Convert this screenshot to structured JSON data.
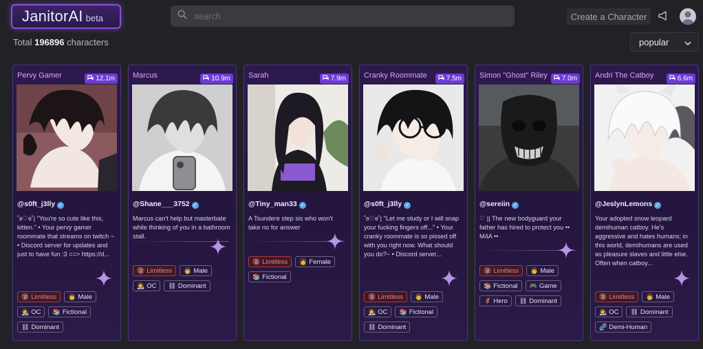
{
  "header": {
    "logo": "JanitorAI",
    "logo_sub": "beta",
    "search_placeholder": "search",
    "create_label": "Create a Character"
  },
  "summary": {
    "prefix": "Total",
    "count": "196896",
    "suffix": "characters"
  },
  "sort": {
    "selected": "popular"
  },
  "colors": {
    "accent": "#8b4fe0",
    "badge": "#6d3bd6",
    "limitless": "#ff7a7a",
    "title": "#e3a0ff"
  },
  "cards": [
    {
      "name": "Pervy Gamer",
      "count": "12.1m",
      "author": "@s0ft_j3lly",
      "description": "˚ʚ♡ɞ˚| \"You're so cute like this, kitten.\" • Your pervy gamer roommate that streams on twitch ~ • Discord server for updates and just to have fun :3 ==> https://d...",
      "tags": [
        {
          "icon": "🔞",
          "label": "Limitless",
          "red": true
        },
        {
          "icon": "👨",
          "label": "Male"
        },
        {
          "icon": "🧑‍🎨",
          "label": "OC"
        },
        {
          "icon": "📚",
          "label": "Fictional"
        },
        {
          "icon": "⛓",
          "label": "Dominant"
        }
      ]
    },
    {
      "name": "Marcus",
      "count": "10.9m",
      "author": "@Shane___3752",
      "description": "Marcus can't help but masterbate while thinking of you in a bathroom stall.",
      "tags": [
        {
          "icon": "🔞",
          "label": "Limitless",
          "red": true
        },
        {
          "icon": "👨",
          "label": "Male"
        },
        {
          "icon": "🧑‍🎨",
          "label": "OC"
        },
        {
          "icon": "⛓",
          "label": "Dominant"
        }
      ]
    },
    {
      "name": "Sarah",
      "count": "7.9m",
      "author": "@Tiny_man33",
      "description": "A Tsundere step sis who won't take no for answer",
      "tags": [
        {
          "icon": "🔞",
          "label": "Limitless",
          "red": true
        },
        {
          "icon": "👩",
          "label": "Female"
        },
        {
          "icon": "📚",
          "label": "Fictional"
        }
      ]
    },
    {
      "name": "Cranky Roommate",
      "count": "7.5m",
      "author": "@s0ft_j3lly",
      "description": "˚ʚ♡ɞ˚| \"Let me study or I will snap your fucking fingers off...\" • Your cranky roommate is so pissed off with you right now. What should you do?~ • Discord server...",
      "tags": [
        {
          "icon": "🔞",
          "label": "Limitless",
          "red": true
        },
        {
          "icon": "👨",
          "label": "Male"
        },
        {
          "icon": "🧑‍🎨",
          "label": "OC"
        },
        {
          "icon": "📚",
          "label": "Fictional"
        },
        {
          "icon": "⛓",
          "label": "Dominant"
        }
      ]
    },
    {
      "name": "Simon \"Ghost\" Riley",
      "count": "7.0m",
      "author": "@sereiin",
      "description": "♡ || The new bodyguard your father has hired to protect you •• M4A ••",
      "tags": [
        {
          "icon": "🔞",
          "label": "Limitless",
          "red": true
        },
        {
          "icon": "👨",
          "label": "Male"
        },
        {
          "icon": "📚",
          "label": "Fictional"
        },
        {
          "icon": "🎮",
          "label": "Game"
        },
        {
          "icon": "🦸",
          "label": "Hero"
        },
        {
          "icon": "⛓",
          "label": "Dominant"
        }
      ]
    },
    {
      "name": "Andri The Catboy",
      "count": "6.6m",
      "author": "@JeslynLemons",
      "description": "Your adopted snow leopard demihuman catboy. He's aggressive and hates humans; in this world, demihumans are used as pleasure slaves and little else. Often when catboy...",
      "tags": [
        {
          "icon": "🔞",
          "label": "Limitless",
          "red": true
        },
        {
          "icon": "👨",
          "label": "Male"
        },
        {
          "icon": "🧑‍🎨",
          "label": "OC"
        },
        {
          "icon": "⛓",
          "label": "Dominant"
        },
        {
          "icon": "🧬",
          "label": "Demi-Human"
        }
      ]
    }
  ]
}
